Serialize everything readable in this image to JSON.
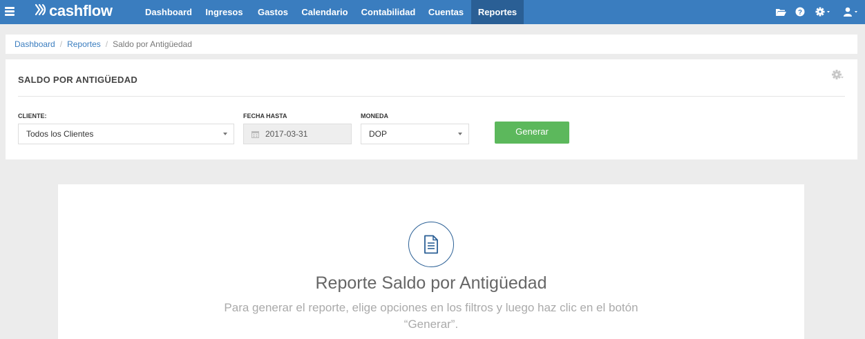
{
  "app": {
    "logo_text": "cashflow"
  },
  "nav": {
    "items": [
      {
        "label": "Dashboard",
        "active": false
      },
      {
        "label": "Ingresos",
        "active": false
      },
      {
        "label": "Gastos",
        "active": false
      },
      {
        "label": "Calendario",
        "active": false
      },
      {
        "label": "Contabilidad",
        "active": false
      },
      {
        "label": "Cuentas",
        "active": false
      },
      {
        "label": "Reportes",
        "active": true
      }
    ],
    "right_icons": [
      "folder-open-icon",
      "help-icon",
      "gear-icon",
      "user-icon"
    ]
  },
  "breadcrumb": {
    "items": [
      "Dashboard",
      "Reportes"
    ],
    "current": "Saldo por Antigüedad",
    "separator": "/"
  },
  "filters": {
    "title": "SALDO POR ANTIGÜEDAD",
    "cliente": {
      "label": "CLIENTE:",
      "value": "Todos los Clientes"
    },
    "fecha_hasta": {
      "label": "FECHA HASTA",
      "value": "2017-03-31"
    },
    "moneda": {
      "label": "MONEDA",
      "value": "DOP"
    },
    "generate_label": "Generar"
  },
  "empty_state": {
    "title": "Reporte Saldo por Antigüedad",
    "description": "Para generar el reporte, elige opciones en los filtros y luego haz clic en el botón “Generar”."
  },
  "colors": {
    "nav_bg": "#3a7dbf",
    "nav_active": "#2a5f95",
    "link": "#3a7dbf",
    "success": "#5cb85c",
    "page_bg": "#ececec"
  }
}
